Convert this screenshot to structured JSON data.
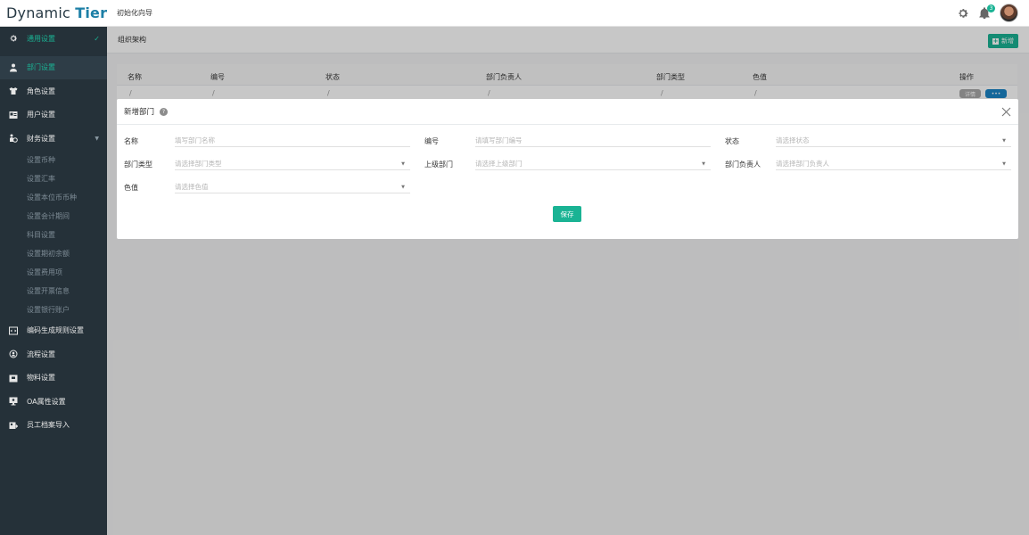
{
  "header": {
    "logo_main": "Dynamic ",
    "logo_accent": "Tier",
    "nav_label": "初始化向导",
    "notification_count": "3",
    "icons": [
      "gear-icon",
      "bell-icon",
      "avatar"
    ]
  },
  "sidebar": {
    "top": {
      "label": "通用设置",
      "icon": "gear-icon"
    },
    "items": [
      {
        "label": "部门设置",
        "icon": "org-icon"
      },
      {
        "label": "角色设置",
        "icon": "shirt-icon"
      },
      {
        "label": "用户设置",
        "icon": "id-card-icon"
      },
      {
        "label": "财务设置",
        "icon": "finance-icon"
      }
    ],
    "sub_items": [
      "设置币种",
      "设置汇率",
      "设置本位币币种",
      "设置会计期间",
      "科目设置",
      "设置期初余额",
      "设置费用项",
      "设置开票信息",
      "设置银行账户"
    ],
    "bottom_items": [
      {
        "label": "编码生成规则设置",
        "icon": "code-icon"
      },
      {
        "label": "流程设置",
        "icon": "flow-icon"
      },
      {
        "label": "物料设置",
        "icon": "box-icon"
      },
      {
        "label": "OA属性设置",
        "icon": "monitor-icon"
      },
      {
        "label": "员工档案导入",
        "icon": "import-icon"
      }
    ]
  },
  "page": {
    "title": "组织架构",
    "add_button": "新增"
  },
  "table": {
    "columns": [
      "名称",
      "编号",
      "状态",
      "部门负责人",
      "部门类型",
      "色值",
      "操作"
    ],
    "row": [
      "/",
      "/",
      "/",
      "/",
      "/",
      "/"
    ],
    "row_actions": [
      "详情",
      "•••"
    ]
  },
  "modal": {
    "title": "新增部门",
    "fields": [
      {
        "label": "名称",
        "placeholder": "填写部门名称",
        "dropdown": false
      },
      {
        "label": "编号",
        "placeholder": "请填写部门编号",
        "dropdown": false
      },
      {
        "label": "状态",
        "placeholder": "请选择状态",
        "dropdown": true
      },
      {
        "label": "部门类型",
        "placeholder": "请选择部门类型",
        "dropdown": true
      },
      {
        "label": "上级部门",
        "placeholder": "请选择上级部门",
        "dropdown": true
      },
      {
        "label": "部门负责人",
        "placeholder": "请选择部门负责人",
        "dropdown": true
      },
      {
        "label": "色值",
        "placeholder": "请选择色值",
        "dropdown": true
      }
    ],
    "save_label": "保存"
  },
  "colors": {
    "accent": "#1ab394",
    "sidebar": "#253139",
    "brand": "#1d7fa6"
  }
}
